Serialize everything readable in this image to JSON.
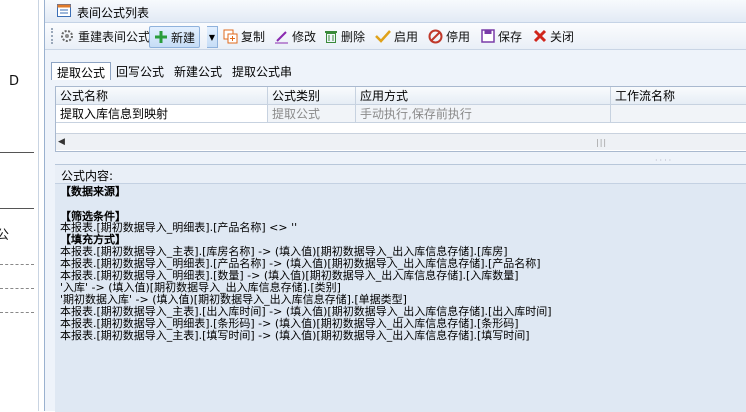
{
  "background": {
    "left_letter": "D",
    "left_char": "公"
  },
  "window": {
    "title": "表间公式列表",
    "icon": "form-list-icon"
  },
  "toolbar": {
    "items": [
      {
        "label": "重建表间公式",
        "icon": "gear-refresh-icon"
      },
      {
        "label": "新建",
        "icon": "plus-icon"
      },
      {
        "label": "复制",
        "icon": "copy-icon"
      },
      {
        "label": "修改",
        "icon": "pencil-icon"
      },
      {
        "label": "删除",
        "icon": "trash-icon"
      },
      {
        "label": "启用",
        "icon": "check-icon"
      },
      {
        "label": "停用",
        "icon": "stop-icon"
      },
      {
        "label": "保存",
        "icon": "save-icon"
      },
      {
        "label": "关闭",
        "icon": "close-icon"
      }
    ]
  },
  "tabs": [
    "提取公式",
    "回写公式",
    "新建公式",
    "提取公式串"
  ],
  "active_tab": "提取公式",
  "grid": {
    "columns": [
      "公式名称",
      "公式类别",
      "应用方式",
      "工作流名称"
    ],
    "rows": [
      [
        "提取入库信息到映射",
        "提取公式",
        "手动执行,保存前执行",
        ""
      ]
    ]
  },
  "formula": {
    "header": "公式内容:",
    "lines": [
      "【数据来源】",
      "",
      "【筛选条件】",
      " 本报表.[期初数据导入_明细表].[产品名称] <> ''",
      "【填充方式】",
      " 本报表.[期初数据导入_主表].[库房名称]   -> (填入值)[期初数据导入_出入库信息存储].[库房]",
      " 本报表.[期初数据导入_明细表].[产品名称]   -> (填入值)[期初数据导入_出入库信息存储].[产品名称]",
      " 本报表.[期初数据导入_明细表].[数量]   -> (填入值)[期初数据导入_出入库信息存储].[入库数量]",
      " '入库'   -> (填入值)[期初数据导入_出入库信息存储].[类别]",
      " '期初数据入库'   -> (填入值)[期初数据导入_出入库信息存储].[单据类型]",
      " 本报表.[期初数据导入_主表].[出入库时间]   -> (填入值)[期初数据导入_出入库信息存储].[出入库时间]",
      " 本报表.[期初数据导入_明细表].[条形码]   -> (填入值)[期初数据导入_出入库信息存储].[条形码]",
      " 本报表.[期初数据导入_主表].[填写时间]   -> (填入值)[期初数据导入_出入库信息存储].[填写时间]"
    ]
  },
  "colors": {
    "accent": "#3b6fb6",
    "panel": "#dfe8f3",
    "new_green": "#2a9d3c",
    "close_red": "#d0261c"
  }
}
